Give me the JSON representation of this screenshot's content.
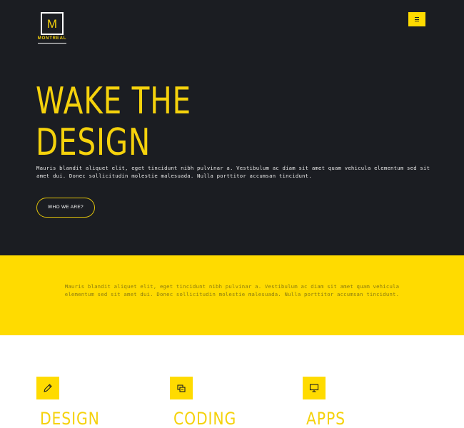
{
  "brand": {
    "letter": "M",
    "name": "MONTREAL",
    "accent": "#ffdb00",
    "dark": "#1b1d22"
  },
  "nav": {
    "menu_icon": "hamburger-icon"
  },
  "hero": {
    "title_line1": "WAKE THE",
    "title_line2": "DESIGN",
    "text": "Mauris blandit aliquet elit, eget tincidunt nibh pulvinar a. Vestibulum ac diam sit amet quam vehicula elementum sed sit amet dui. Donec sollicitudin molestie malesuada. Nulla porttitor accumsan tincidunt.",
    "button_label": "WHO WE ARE?"
  },
  "band": {
    "text": "Mauris blandit aliquet elit, eget tincidunt nibh pulvinar a. Vestibulum ac diam sit amet quam vehicula elementum sed sit amet dui. Donec sollicitudin molestie malesuada. Nulla porttitor accumsan tincidunt."
  },
  "services": [
    {
      "title": "DESIGN",
      "icon": "pencil-icon"
    },
    {
      "title": "CODING",
      "icon": "code-icon"
    },
    {
      "title": "APPS",
      "icon": "monitor-icon"
    }
  ]
}
